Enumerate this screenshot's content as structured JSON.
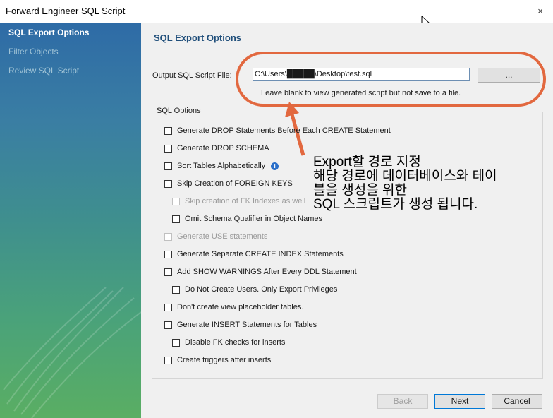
{
  "window": {
    "title": "Forward Engineer SQL Script",
    "close_glyph": "×"
  },
  "sidebar": {
    "items": [
      {
        "label": "SQL Export Options"
      },
      {
        "label": "Filter Objects"
      },
      {
        "label": "Review SQL Script"
      }
    ]
  },
  "main": {
    "heading": "SQL Export Options",
    "file_label": "Output SQL Script File:",
    "file_value": "C:\\Users\\█████\\Desktop\\test.sql",
    "browse_label": "...",
    "hint": "Leave blank to view generated script but not save to a file.",
    "options_title": "SQL Options",
    "options": [
      {
        "label": "Generate DROP Statements Before Each CREATE Statement",
        "checked": false,
        "disabled": false,
        "indent": false
      },
      {
        "label": "Generate DROP SCHEMA",
        "checked": false,
        "disabled": false,
        "indent": false
      },
      {
        "label": "Sort Tables Alphabetically",
        "checked": false,
        "disabled": false,
        "indent": false,
        "info": true
      },
      {
        "label": "Skip Creation of FOREIGN KEYS",
        "checked": false,
        "disabled": false,
        "indent": false
      },
      {
        "label": "Skip creation of FK Indexes as well",
        "checked": false,
        "disabled": true,
        "indent": true
      },
      {
        "label": "Omit Schema Qualifier in Object Names",
        "checked": false,
        "disabled": false,
        "indent": true
      },
      {
        "label": "Generate USE statements",
        "checked": false,
        "disabled": true,
        "indent": false
      },
      {
        "label": "Generate Separate CREATE INDEX Statements",
        "checked": false,
        "disabled": false,
        "indent": false
      },
      {
        "label": "Add SHOW WARNINGS After Every DDL Statement",
        "checked": false,
        "disabled": false,
        "indent": false
      },
      {
        "label": "Do Not Create Users. Only Export Privileges",
        "checked": false,
        "disabled": false,
        "indent": true
      },
      {
        "label": "Don't create view placeholder tables.",
        "checked": false,
        "disabled": false,
        "indent": false
      },
      {
        "label": "Generate INSERT Statements for Tables",
        "checked": false,
        "disabled": false,
        "indent": false
      },
      {
        "label": "Disable FK checks for inserts",
        "checked": false,
        "disabled": false,
        "indent": true
      },
      {
        "label": "Create triggers after inserts",
        "checked": false,
        "disabled": false,
        "indent": false
      }
    ],
    "annotation": "Export할 경로 지정\n해당 경로에 데이터베이스와 테이\n블을 생성을 위한\nSQL 스크립트가 생성 됩니다."
  },
  "footer": {
    "back_label": "Back",
    "next_label": "Next",
    "cancel_label": "Cancel"
  },
  "colors": {
    "highlight": "#e2683f",
    "accent": "#1f4e7a",
    "sidebar_top": "#2e6ba6",
    "sidebar_bottom": "#5aae63"
  },
  "icons": {
    "info": "info-icon",
    "close": "close-icon",
    "cursor": "mouse-cursor-icon"
  }
}
